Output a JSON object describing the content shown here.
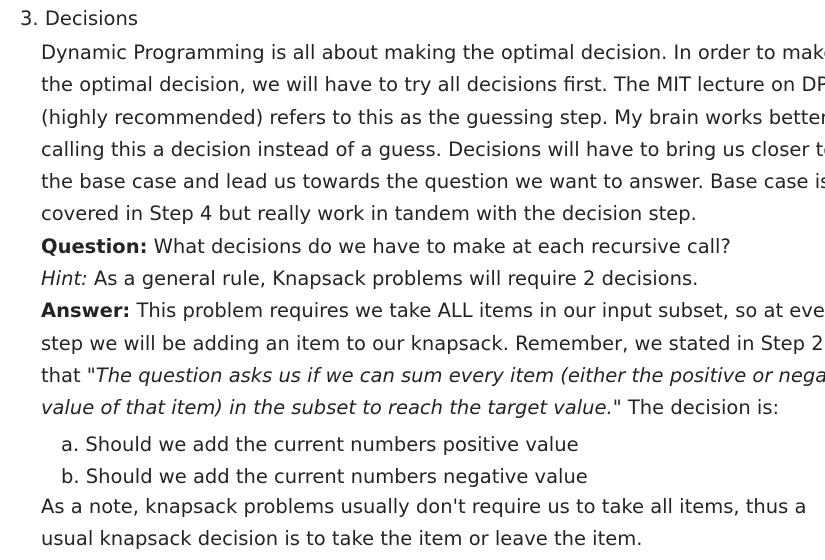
{
  "section": {
    "number": "3.",
    "title": "Decisions"
  },
  "intro_lines": [
    "Dynamic Programming is all about making the optimal decision. In order to make",
    "the optimal decision, we will have to try all decisions first. The MIT lecture on DP",
    "(highly recommended) refers to this as the guessing step. My brain works better",
    "calling this a decision instead of a guess. Decisions will have to bring us closer to",
    "the base case and lead us towards the question we want to answer. Base case is",
    "covered in Step 4 but really work in tandem with the decision step."
  ],
  "question": {
    "label": "Question:",
    "text": " What decisions do we have to make at each recursive call?"
  },
  "hint": {
    "label": "Hint:",
    "text": " As a general rule, Knapsack problems will require 2 decisions."
  },
  "answer": {
    "label": "Answer:",
    "line1": " This problem requires we take ALL items in our input subset, so at every",
    "line2": "step we will be adding an item to our knapsack. Remember, we stated in Step 2",
    "line3_prefix": "that \"",
    "line3_italic": "The question asks us if we can sum every item (either the positive or negative",
    "line4_italic": "value of that item) in the subset to reach the target value.",
    "line4_suffix": "\" The decision is:"
  },
  "decisions": [
    {
      "marker": "a.",
      "text": "Should we add the current numbers positive value"
    },
    {
      "marker": "b.",
      "text": "Should we add the current numbers negative value"
    }
  ],
  "note_lines": [
    "As a note, knapsack problems usually don't require us to take all items, thus a",
    "usual knapsack decision is to take the item or leave the item."
  ]
}
